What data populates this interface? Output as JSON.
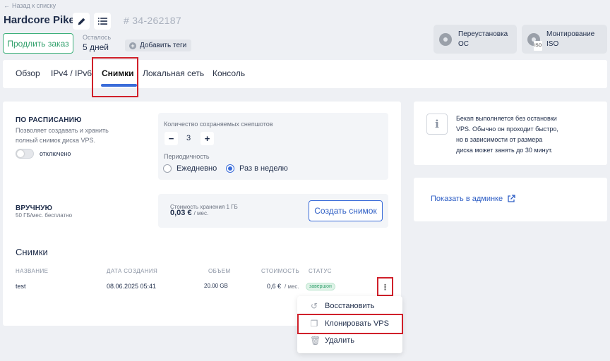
{
  "header": {
    "back_label": "Назад к списку",
    "title": "Hardcore Pike",
    "vps_id": "# 34-262187",
    "prolong_label": "Продлить заказ",
    "remaining_label": "Осталось",
    "remaining_value": "5 дней",
    "add_tags_label": "Добавить теги",
    "reinstall_line1": "Переустановка",
    "reinstall_line2": "ОС",
    "mount_line1": "Монтирование",
    "mount_line2": "ISO",
    "iso_tag": "ISO"
  },
  "tabs": [
    {
      "label": "Обзор"
    },
    {
      "label": "IPv4 / IPv6"
    },
    {
      "label": "Снимки"
    },
    {
      "label": "Локальная сеть"
    },
    {
      "label": "Консоль"
    }
  ],
  "schedule": {
    "title": "ПО РАСПИСАНИЮ",
    "desc_line1": "Позволяет создавать и хранить",
    "desc_line2": "полный снимок диска VPS.",
    "toggle_label": "отключено",
    "count_label": "Количество сохраняемых снепшотов",
    "count_value": "3",
    "minus": "−",
    "plus": "+",
    "period_label": "Периодичность",
    "period_options": [
      "Ежедневно",
      "Раз в неделю"
    ],
    "period_selected": "Раз в неделю"
  },
  "manual": {
    "title": "ВРУЧНУЮ",
    "desc": "50 ГБ/мес. бесплатно",
    "storage_label": "Стоимость хранения 1 ГБ",
    "storage_price": "0,03 €",
    "storage_unit": "/ мес.",
    "create_label": "Создать снимок"
  },
  "snapshots": {
    "title": "Снимки",
    "columns": [
      "НАЗВАНИЕ",
      "ДАТА СОЗДАНИЯ",
      "ОБЪЕМ",
      "СТОИМОСТЬ",
      "СТАТУС"
    ],
    "rows": [
      {
        "name": "test",
        "date": "08.06.2025 05:41",
        "size": "20.00 GB",
        "cost": "0,6 €",
        "cost_unit": "/ мес.",
        "status": "завершон"
      }
    ],
    "kebab": "⋮"
  },
  "context_menu": [
    {
      "label": "Восстановить",
      "icon": "restore-icon"
    },
    {
      "label": "Клонировать VPS",
      "icon": "clone-icon"
    },
    {
      "label": "Удалить",
      "icon": "trash-icon"
    }
  ],
  "info": {
    "icon": "i",
    "line1": "Бекап выполняется без остановки",
    "line2": "VPS. Обычно он проходит быстро,",
    "line3": "но в зависимости от размера",
    "line4": "диска может занять до 30 минут."
  },
  "admin": {
    "link_label": "Показать в админке"
  },
  "colors": {
    "accent": "#3a6cd9",
    "success": "#2f9f6a",
    "highlight": "#d0202a"
  }
}
